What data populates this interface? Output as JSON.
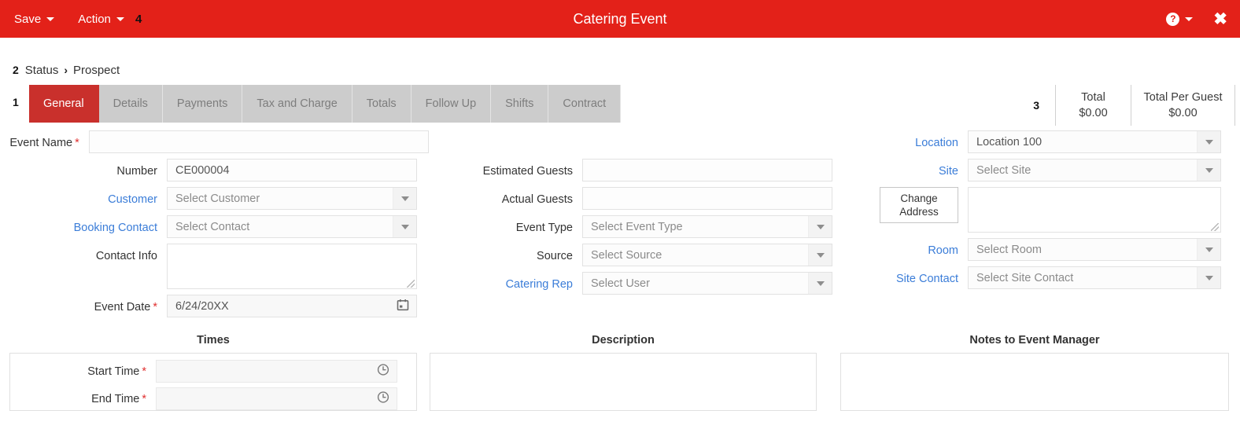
{
  "titlebar": {
    "save_label": "Save",
    "action_label": "Action",
    "step_marker": "4",
    "title": "Catering Event",
    "help_icon_label": "?",
    "close_label": "✖"
  },
  "breadcrumb": {
    "step_marker": "2",
    "label": "Status",
    "separator": "›",
    "value": "Prospect"
  },
  "tabs": {
    "step_marker": "1",
    "items": [
      {
        "label": "General",
        "active": true
      },
      {
        "label": "Details",
        "active": false
      },
      {
        "label": "Payments",
        "active": false
      },
      {
        "label": "Tax and Charge",
        "active": false
      },
      {
        "label": "Totals",
        "active": false
      },
      {
        "label": "Follow Up",
        "active": false
      },
      {
        "label": "Shifts",
        "active": false
      },
      {
        "label": "Contract",
        "active": false
      }
    ]
  },
  "totals": {
    "step_marker": "3",
    "total_label": "Total",
    "total_value": "$0.00",
    "total_per_guest_label": "Total Per Guest",
    "total_per_guest_value": "$0.00"
  },
  "form": {
    "left": {
      "event_name_label": "Event Name",
      "event_name_value": "",
      "number_label": "Number",
      "number_value": "CE000004",
      "customer_label": "Customer",
      "customer_placeholder": "Select Customer",
      "booking_contact_label": "Booking Contact",
      "booking_contact_placeholder": "Select Contact",
      "contact_info_label": "Contact Info",
      "contact_info_value": "",
      "event_date_label": "Event Date",
      "event_date_value": "6/24/20XX"
    },
    "middle": {
      "estimated_guests_label": "Estimated Guests",
      "estimated_guests_value": "",
      "actual_guests_label": "Actual Guests",
      "actual_guests_value": "",
      "event_type_label": "Event Type",
      "event_type_placeholder": "Select Event Type",
      "source_label": "Source",
      "source_placeholder": "Select Source",
      "catering_rep_label": "Catering Rep",
      "catering_rep_placeholder": "Select User"
    },
    "right": {
      "location_label": "Location",
      "location_value": "Location 100",
      "site_label": "Site",
      "site_placeholder": "Select Site",
      "change_address_line1": "Change",
      "change_address_line2": "Address",
      "address_value": "",
      "room_label": "Room",
      "room_placeholder": "Select Room",
      "site_contact_label": "Site Contact",
      "site_contact_placeholder": "Select Site Contact"
    }
  },
  "panels": {
    "times_title": "Times",
    "start_time_label": "Start Time",
    "start_time_value": "",
    "end_time_label": "End Time",
    "end_time_value": "",
    "description_title": "Description",
    "description_value": "",
    "notes_title": "Notes to Event Manager",
    "notes_value": ""
  },
  "colors": {
    "header_red": "#e32119",
    "tab_active_red": "#c9302c",
    "tab_inactive_grey": "#cccccc",
    "link_blue": "#3b7dd8",
    "required_red": "#e03030"
  }
}
